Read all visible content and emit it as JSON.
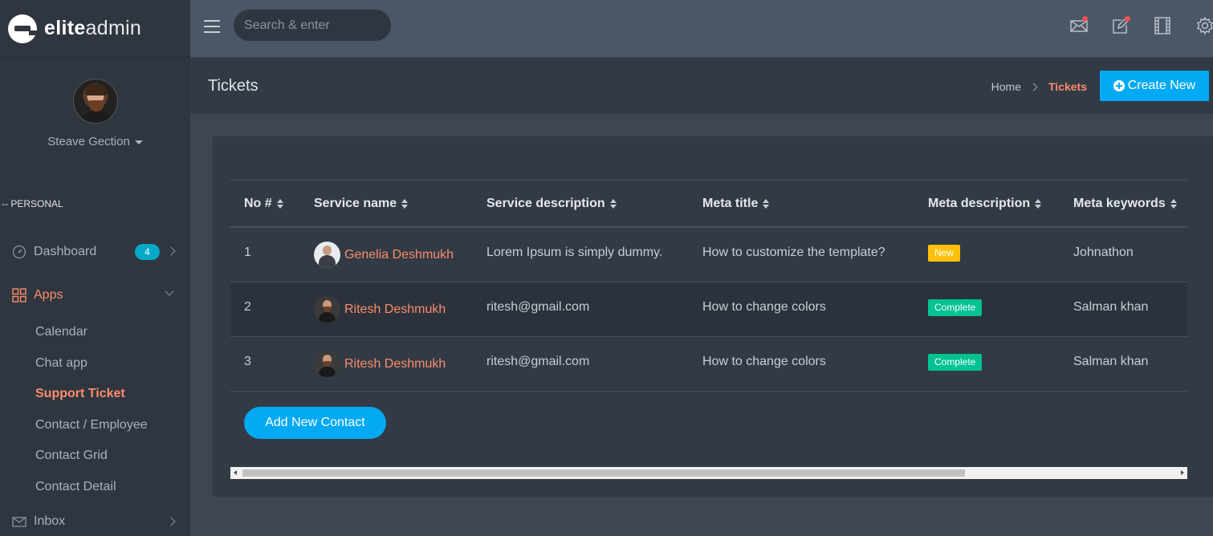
{
  "brand": {
    "name_bold": "elite",
    "name_light": "admin"
  },
  "topbar": {
    "search_placeholder": "Search & enter"
  },
  "profile": {
    "name": "Steave Gection"
  },
  "sidebar": {
    "section_label": "-- PERSONAL",
    "dashboard": {
      "label": "Dashboard",
      "badge": "4"
    },
    "apps": {
      "label": "Apps"
    },
    "sub_items": [
      "Calendar",
      "Chat app",
      "Support Ticket",
      "Contact / Employee",
      "Contact Grid",
      "Contact Detail"
    ],
    "inbox": {
      "label": "Inbox"
    }
  },
  "page": {
    "title": "Tickets",
    "breadcrumb": {
      "home": "Home",
      "current": "Tickets"
    },
    "create_button": "Create New"
  },
  "table": {
    "headers": [
      "No #",
      "Service name",
      "Service description",
      "Meta title",
      "Meta description",
      "Meta keywords"
    ],
    "rows": [
      {
        "no": "1",
        "name": "Genelia Deshmukh",
        "desc": "Lorem Ipsum is simply dummy.",
        "meta_title": "How to customize the template?",
        "status": "New",
        "keywords": "Johnathon"
      },
      {
        "no": "2",
        "name": "Ritesh Deshmukh",
        "desc": "ritesh@gmail.com",
        "meta_title": "How to change colors",
        "status": "Complete",
        "keywords": "Salman khan"
      },
      {
        "no": "3",
        "name": "Ritesh Deshmukh",
        "desc": "ritesh@gmail.com",
        "meta_title": "How to change colors",
        "status": "Complete",
        "keywords": "Salman khan"
      }
    ],
    "add_button": "Add New Contact"
  },
  "colors": {
    "accent": "#fb8c6a",
    "primary": "#03a9f3",
    "badge_new": "#fec107",
    "badge_complete": "#00c292",
    "badge_count": "#03a9c6"
  }
}
